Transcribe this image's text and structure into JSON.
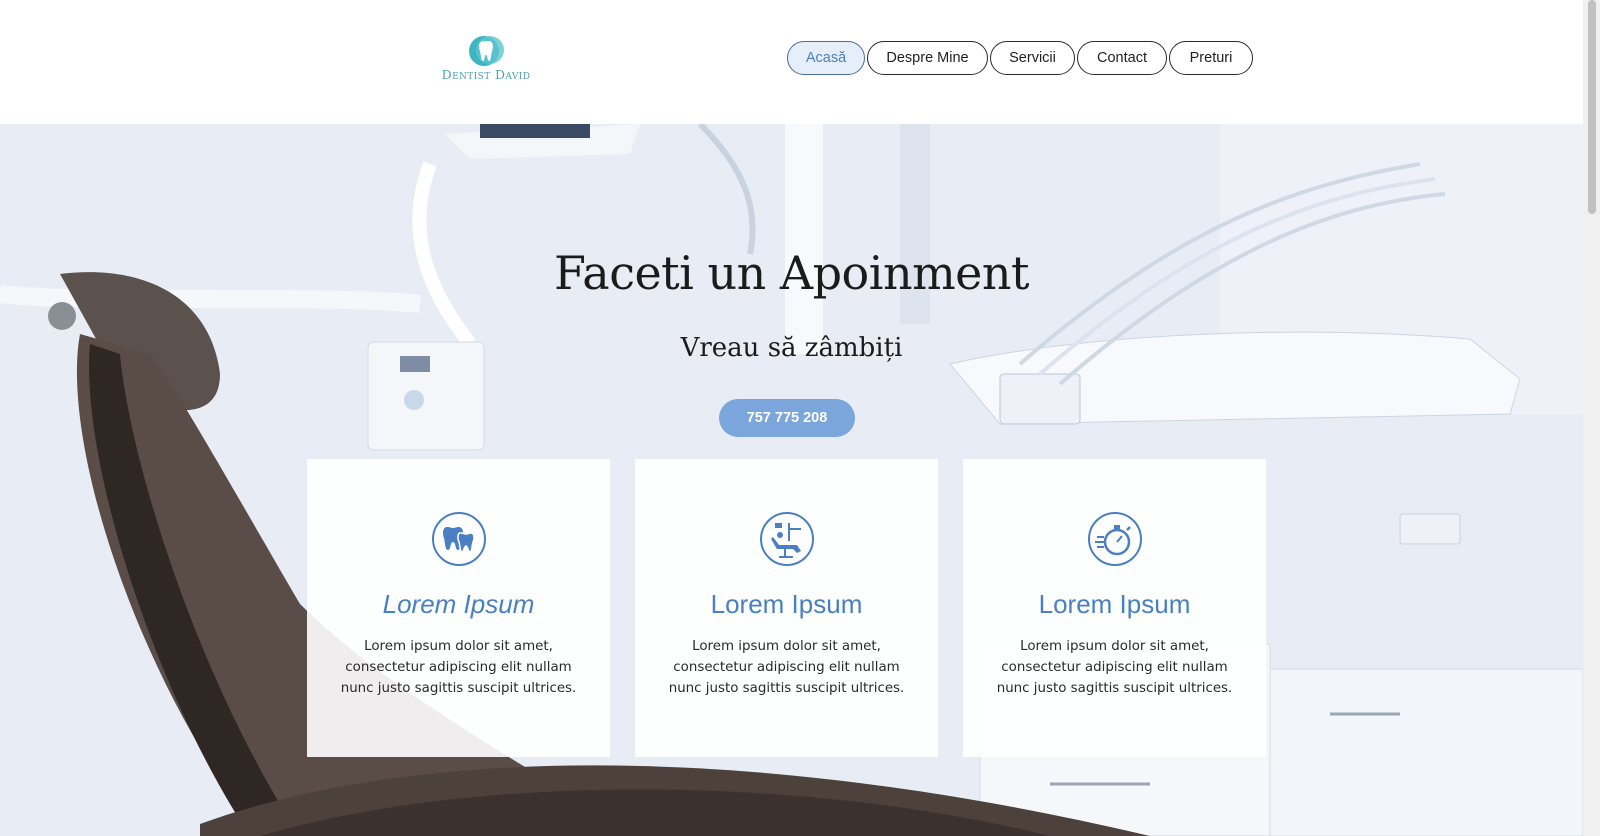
{
  "brand": {
    "logo_text": "Dentist David",
    "accent_color": "#4a7fc1",
    "logo_color": "#4e9fb3"
  },
  "nav": {
    "items": [
      {
        "label": "Acasă",
        "active": true
      },
      {
        "label": "Despre Mine",
        "active": false
      },
      {
        "label": "Servicii",
        "active": false
      },
      {
        "label": "Contact",
        "active": false
      },
      {
        "label": "Preturi",
        "active": false
      }
    ]
  },
  "hero": {
    "title": "Faceti un Apoinment",
    "subtitle": "Vreau să zâmbiți",
    "phone_button": "757 775 208",
    "button_color": "#7aa6dc"
  },
  "cards": [
    {
      "icon": "tooth-icon",
      "title": "Lorem Ipsum",
      "text": "Lorem ipsum dolor sit amet, consectetur adipiscing elit nullam nunc justo sagittis suscipit ultrices."
    },
    {
      "icon": "dental-chair-icon",
      "title": "Lorem Ipsum",
      "text": "Lorem ipsum dolor sit amet, consectetur adipiscing elit nullam nunc justo sagittis suscipit ultrices."
    },
    {
      "icon": "stopwatch-icon",
      "title": "Lorem Ipsum",
      "text": "Lorem ipsum dolor sit amet, consectetur adipiscing elit nullam nunc justo sagittis suscipit ultrices."
    }
  ]
}
